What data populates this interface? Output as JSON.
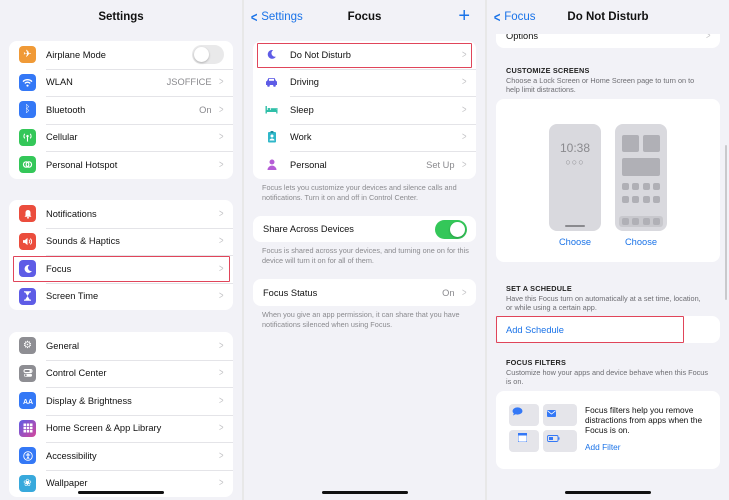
{
  "settings": {
    "title": "Settings",
    "group1": [
      {
        "label": "Airplane Mode",
        "icon": "airplane-icon",
        "color": "#f09a37",
        "toggle": "off"
      },
      {
        "label": "WLAN",
        "icon": "wifi-icon",
        "color": "#3478f6",
        "value": "JSOFFICE"
      },
      {
        "label": "Bluetooth",
        "icon": "bluetooth-icon",
        "color": "#3478f6",
        "value": "On"
      },
      {
        "label": "Cellular",
        "icon": "antenna-icon",
        "color": "#34c759",
        "value": ""
      },
      {
        "label": "Personal Hotspot",
        "icon": "hotspot-icon",
        "color": "#34c759",
        "value": ""
      }
    ],
    "group2": [
      {
        "label": "Notifications",
        "icon": "bell-icon",
        "color": "#eb4d3d"
      },
      {
        "label": "Sounds & Haptics",
        "icon": "speaker-icon",
        "color": "#eb4d3d"
      },
      {
        "label": "Focus",
        "icon": "moon-icon",
        "color": "#5e5ce6"
      },
      {
        "label": "Screen Time",
        "icon": "hourglass-icon",
        "color": "#5e5ce6"
      }
    ],
    "group3": [
      {
        "label": "General",
        "icon": "gear-icon",
        "color": "#8e8e93"
      },
      {
        "label": "Control Center",
        "icon": "switches-icon",
        "color": "#8e8e93"
      },
      {
        "label": "Display & Brightness",
        "icon": "display-icon",
        "color": "#3478f6"
      },
      {
        "label": "Home Screen & App Library",
        "icon": "grid-icon",
        "color": "#5e5ce6"
      },
      {
        "label": "Accessibility",
        "icon": "accessibility-icon",
        "color": "#3478f6"
      },
      {
        "label": "Wallpaper",
        "icon": "flower-icon",
        "color": "#38a9dc"
      }
    ]
  },
  "focus": {
    "back": "Settings",
    "title": "Focus",
    "modes": [
      {
        "label": "Do Not Disturb",
        "icon": "moon-icon",
        "color": "#5e5ce6",
        "value": ""
      },
      {
        "label": "Driving",
        "icon": "car-icon",
        "color": "#5e5ce6",
        "value": ""
      },
      {
        "label": "Sleep",
        "icon": "bed-icon",
        "color": "#2fbfa8",
        "value": ""
      },
      {
        "label": "Work",
        "icon": "badge-icon",
        "color": "#2fb7c9",
        "value": ""
      },
      {
        "label": "Personal",
        "icon": "person-icon",
        "color": "#b55cd6",
        "value": "Set Up"
      }
    ],
    "modes_footer": "Focus lets you customize your devices and silence calls and notifications. Turn it on and off in Control Center.",
    "share_label": "Share Across Devices",
    "share_footer": "Focus is shared across your devices, and turning one on for this device will turn it on for all of them.",
    "status_label": "Focus Status",
    "status_value": "On",
    "status_footer": "When you give an app permission, it can share that you have notifications silenced when using Focus."
  },
  "dnd": {
    "back": "Focus",
    "title": "Do Not Disturb",
    "options_label": "Options",
    "customize_header": "CUSTOMIZE SCREENS",
    "customize_desc": "Choose a Lock Screen or Home Screen page to turn on to help limit distractions.",
    "lock_time": "10:38",
    "choose_lock": "Choose",
    "choose_home": "Choose",
    "schedule_header": "SET A SCHEDULE",
    "schedule_desc": "Have this Focus turn on automatically at a set time, location, or while using a certain app.",
    "add_schedule": "Add Schedule",
    "filters_header": "FOCUS FILTERS",
    "filters_desc": "Customize how your apps and device behave when this Focus is on.",
    "filters_text": "Focus filters help you remove distractions from apps when the Focus is on.",
    "add_filter": "Add Filter"
  }
}
